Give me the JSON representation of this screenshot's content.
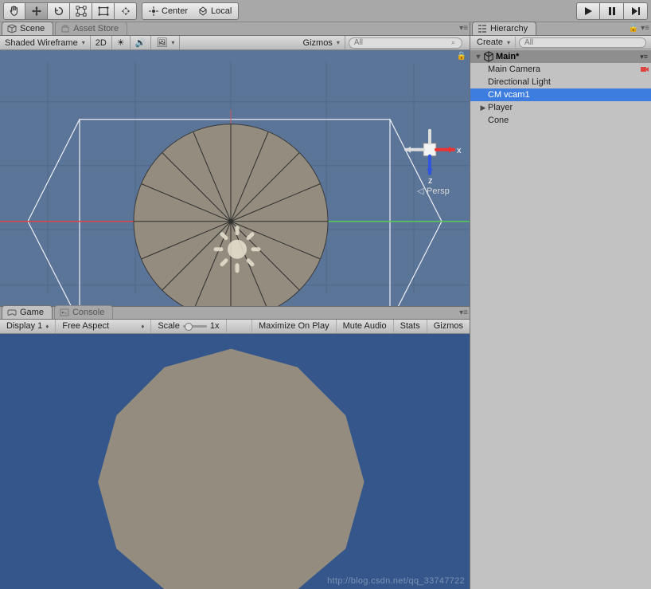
{
  "toolbar": {
    "center_label": "Center",
    "local_label": "Local"
  },
  "tabs": {
    "scene": "Scene",
    "asset_store": "Asset Store",
    "game": "Game",
    "console": "Console",
    "hierarchy": "Hierarchy"
  },
  "scene_toolbar": {
    "shading": "Shaded Wireframe",
    "dim": "2D",
    "gizmos": "Gizmos",
    "search_placeholder": "All"
  },
  "scene_gizmo": {
    "x": "x",
    "z": "z",
    "persp": "Persp"
  },
  "game_toolbar": {
    "display": "Display 1",
    "aspect": "Free Aspect",
    "scale_label": "Scale",
    "scale_value": "1x",
    "maximize": "Maximize On Play",
    "mute": "Mute Audio",
    "stats": "Stats",
    "gizmos": "Gizmos"
  },
  "hierarchy": {
    "create": "Create",
    "search_placeholder": "All",
    "scene_name": "Main*",
    "items": [
      {
        "label": "Main Camera"
      },
      {
        "label": "Directional Light"
      },
      {
        "label": "CM vcam1"
      },
      {
        "label": "Player"
      },
      {
        "label": "Cone"
      }
    ]
  },
  "watermark": "http://blog.csdn.net/qq_33747722"
}
